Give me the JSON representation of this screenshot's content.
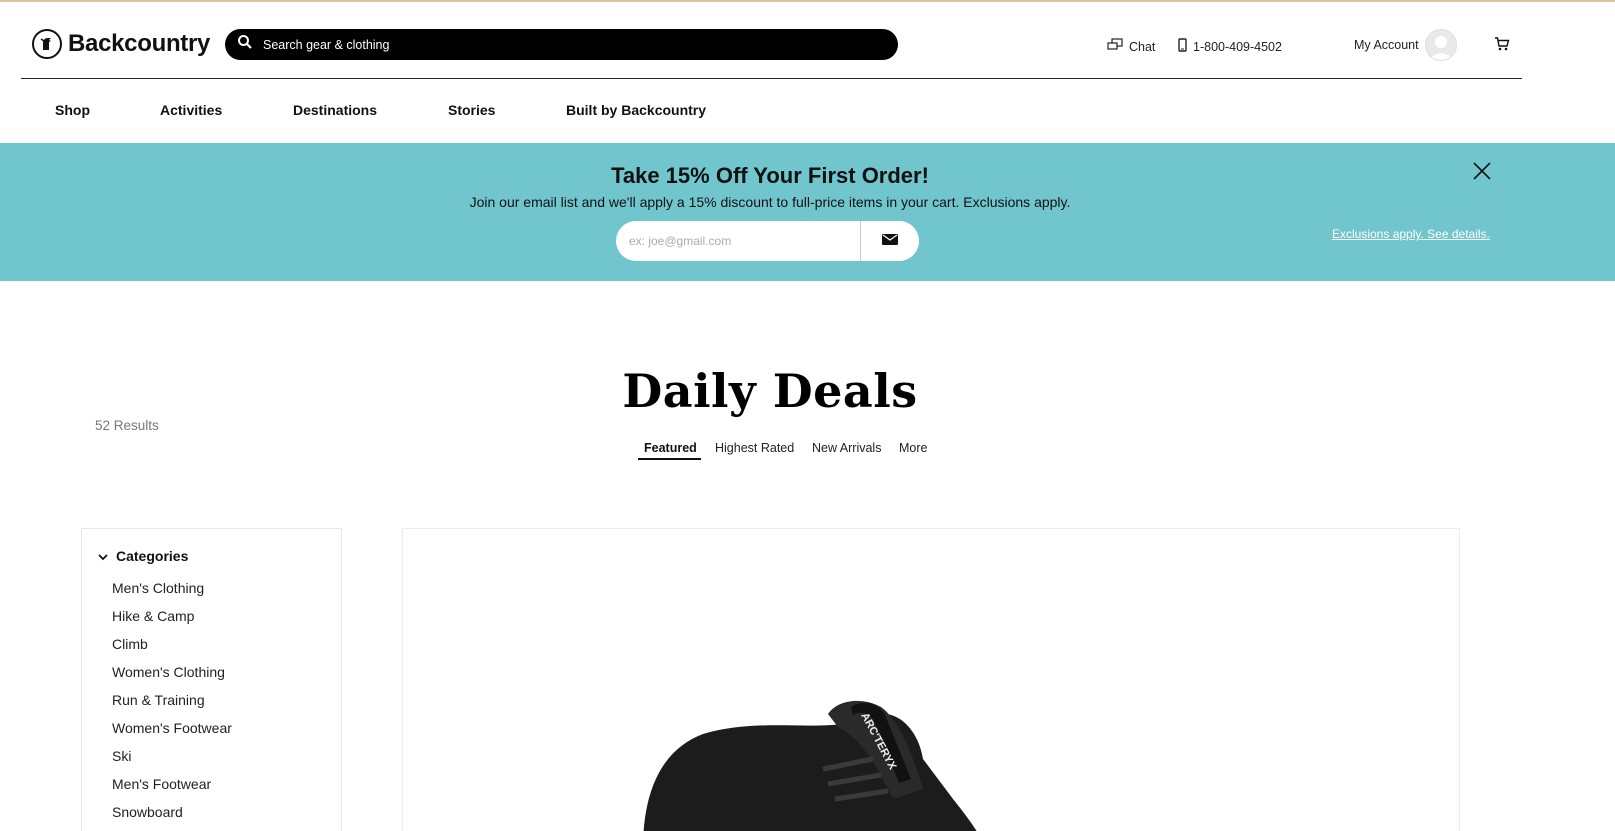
{
  "header": {
    "logo_text": "Backcountry",
    "search_placeholder": "Search gear & clothing",
    "chat_label": "Chat",
    "phone_label": "1-800-409-4502",
    "account_label": "My Account"
  },
  "nav": {
    "items": [
      "Shop",
      "Activities",
      "Destinations",
      "Stories",
      "Built by Backcountry"
    ]
  },
  "promo": {
    "title": "Take 15% Off Your First Order!",
    "subtitle": "Join our email list and we'll apply a 15% discount to full-price items in your cart. Exclusions apply.",
    "email_placeholder": "ex: joe@gmail.com",
    "details_link": "Exclusions apply. See details.",
    "background_color": "#70c6cc"
  },
  "page": {
    "title": "Daily Deals",
    "results_count": "52 Results",
    "sort_tabs": [
      "Featured",
      "Highest Rated",
      "New Arrivals",
      "More"
    ],
    "active_sort": "Featured"
  },
  "sidebar": {
    "categories_label": "Categories",
    "categories": [
      "Men's Clothing",
      "Hike & Camp",
      "Climb",
      "Women's Clothing",
      "Run & Training",
      "Women's Footwear",
      "Ski",
      "Men's Footwear",
      "Snowboard"
    ]
  },
  "product": {
    "brand_text_on_image": "ARC'TERYX"
  },
  "icons": {
    "search": "search-icon",
    "chat": "chat-icon",
    "phone": "phone-icon",
    "cart": "cart-icon",
    "close": "close-icon",
    "mail": "mail-icon",
    "chevron": "chevron-down-icon"
  }
}
